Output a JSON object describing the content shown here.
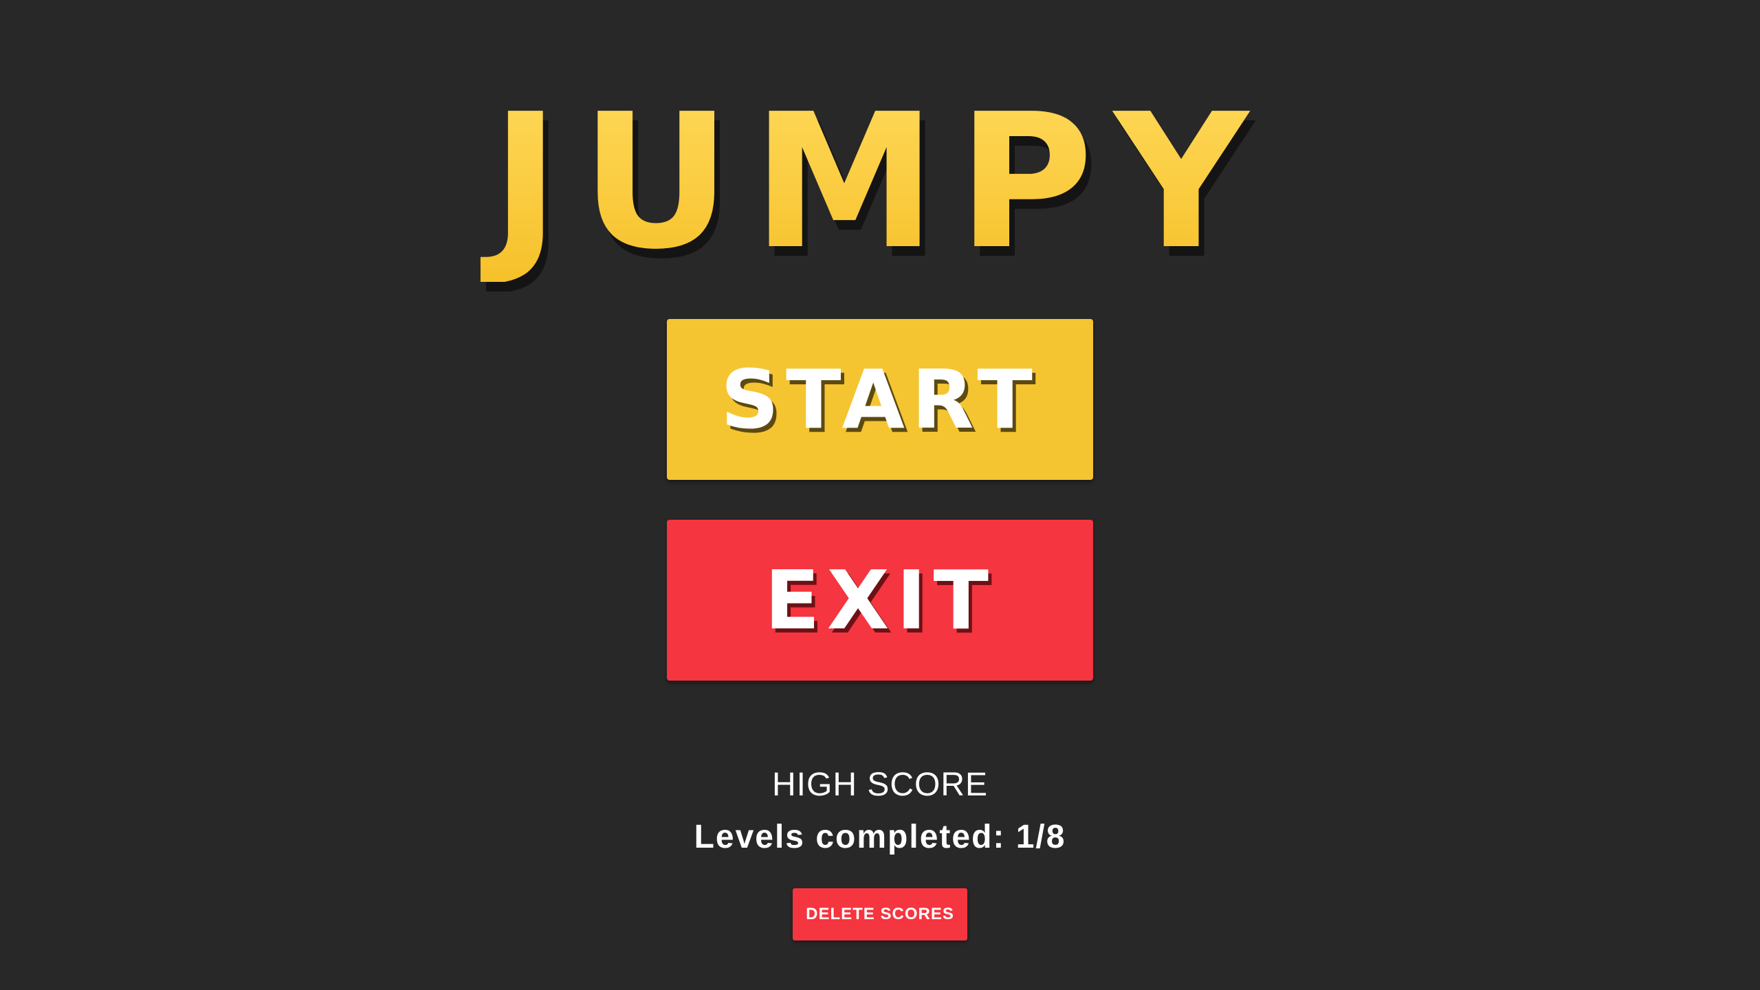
{
  "title": "JUMPY",
  "menu": {
    "start_label": "START",
    "exit_label": "EXIT"
  },
  "scores": {
    "heading": "HIGH SCORE",
    "levels_completed": "Levels completed: 1/8",
    "delete_label": "DELETE SCORES"
  },
  "colors": {
    "background": "#282828",
    "title_yellow": "#fcc737",
    "start_yellow": "#f5c431",
    "exit_red": "#f5353f",
    "delete_red": "#f5353f"
  }
}
